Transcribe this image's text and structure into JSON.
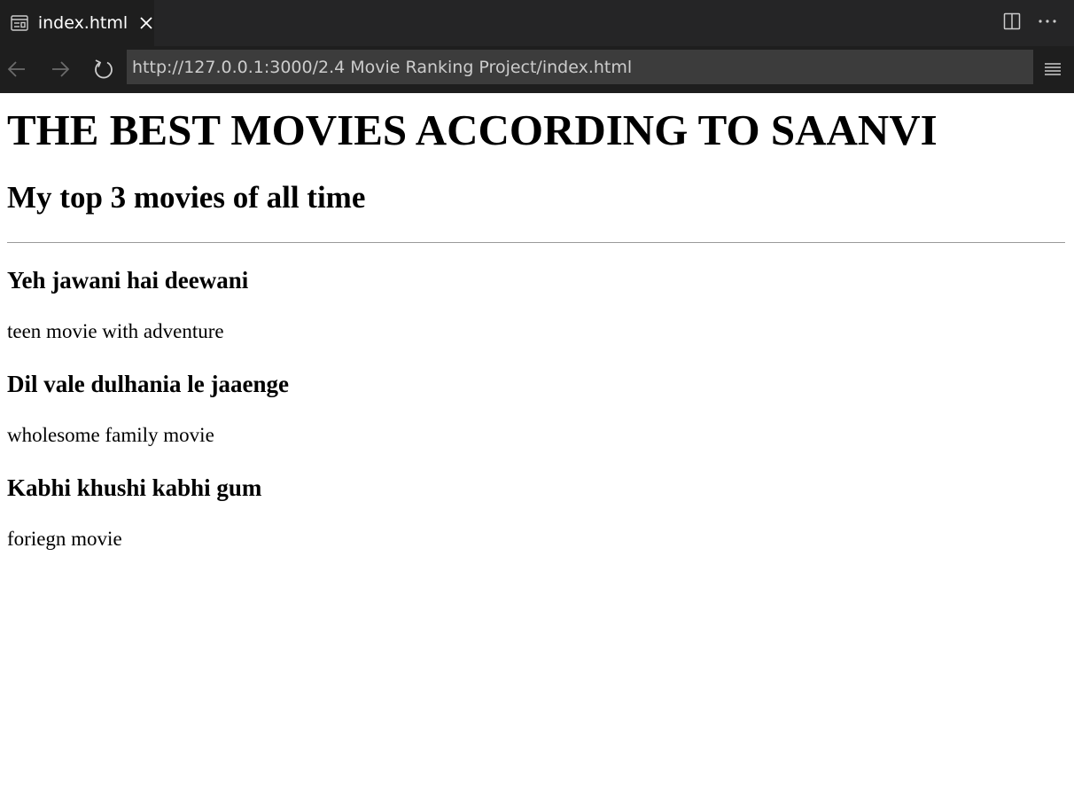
{
  "tab": {
    "icon": "preview-icon",
    "label": "index.html",
    "close_icon": "close-icon"
  },
  "tab_actions": {
    "split": "split-editor-icon",
    "more": "more-icon"
  },
  "nav": {
    "back_icon": "arrow-left-icon",
    "forward_icon": "arrow-right-icon",
    "reload_icon": "reload-icon",
    "url": "http://127.0.0.1:3000/2.4 Movie Ranking Project/index.html",
    "menu_icon": "hamburger-menu-icon"
  },
  "page": {
    "title": "THE BEST MOVIES ACCORDING TO SAANVI",
    "subtitle": "My top 3 movies of all time",
    "movies": [
      {
        "name": "Yeh jawani hai deewani",
        "description": "teen movie with adventure"
      },
      {
        "name": "Dil vale dulhania le jaaenge",
        "description": "wholesome family movie"
      },
      {
        "name": "Kabhi khushi kabhi gum",
        "description": "foriegn movie"
      }
    ]
  },
  "colors": {
    "tabbar_bg": "#252526",
    "active_tab_bg": "#1e1e1e",
    "url_bg": "#3c3c3c",
    "url_text": "#cccccc",
    "page_bg": "#ffffff"
  }
}
